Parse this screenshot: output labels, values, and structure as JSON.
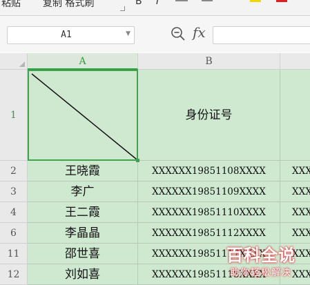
{
  "toolbar": {
    "paste_label": "粘贴",
    "format_painter_label": "复制 格式刷",
    "accent_yellow": "#f2d600",
    "accent_red": "#e02020"
  },
  "formula_bar": {
    "name_box_value": "A1",
    "fx_label": "fx",
    "zoom_icon": "zoom-icon",
    "formula_value": ""
  },
  "sheet": {
    "columns": [
      "A",
      "B",
      ""
    ],
    "header_row": {
      "row_number": "1",
      "a_value": "",
      "b_value": "身份证号"
    },
    "rows": [
      {
        "row_number": "2",
        "name": "王晓霞",
        "id": "XXXXXX19851108XXXX",
        "c_value": "XXX"
      },
      {
        "row_number": "3",
        "name": "李广",
        "id": "XXXXXX19851109XXXX",
        "c_value": "XXX"
      },
      {
        "row_number": "4",
        "name": "王二霞",
        "id": "XXXXXX19851110XXXX",
        "c_value": "XXX"
      },
      {
        "row_number": "6",
        "name": "李晶晶",
        "id": "XXXXXX19851112XXXX",
        "c_value": "XXX"
      },
      {
        "row_number": "11",
        "name": "邵世喜",
        "id": "XXXXXX19851117XXXX",
        "c_value": "XXX"
      },
      {
        "row_number": "12",
        "name": "刘如喜",
        "id": "XXXXXX19851118XXXX",
        "c_value": "XXX"
      }
    ],
    "selected_cell_color": "#3ea34b",
    "cell_fill_color": "#cfe9d1"
  },
  "watermark": {
    "title": "百科全说",
    "subtitle": "助你轻松解决",
    "color": "#e0383e"
  }
}
